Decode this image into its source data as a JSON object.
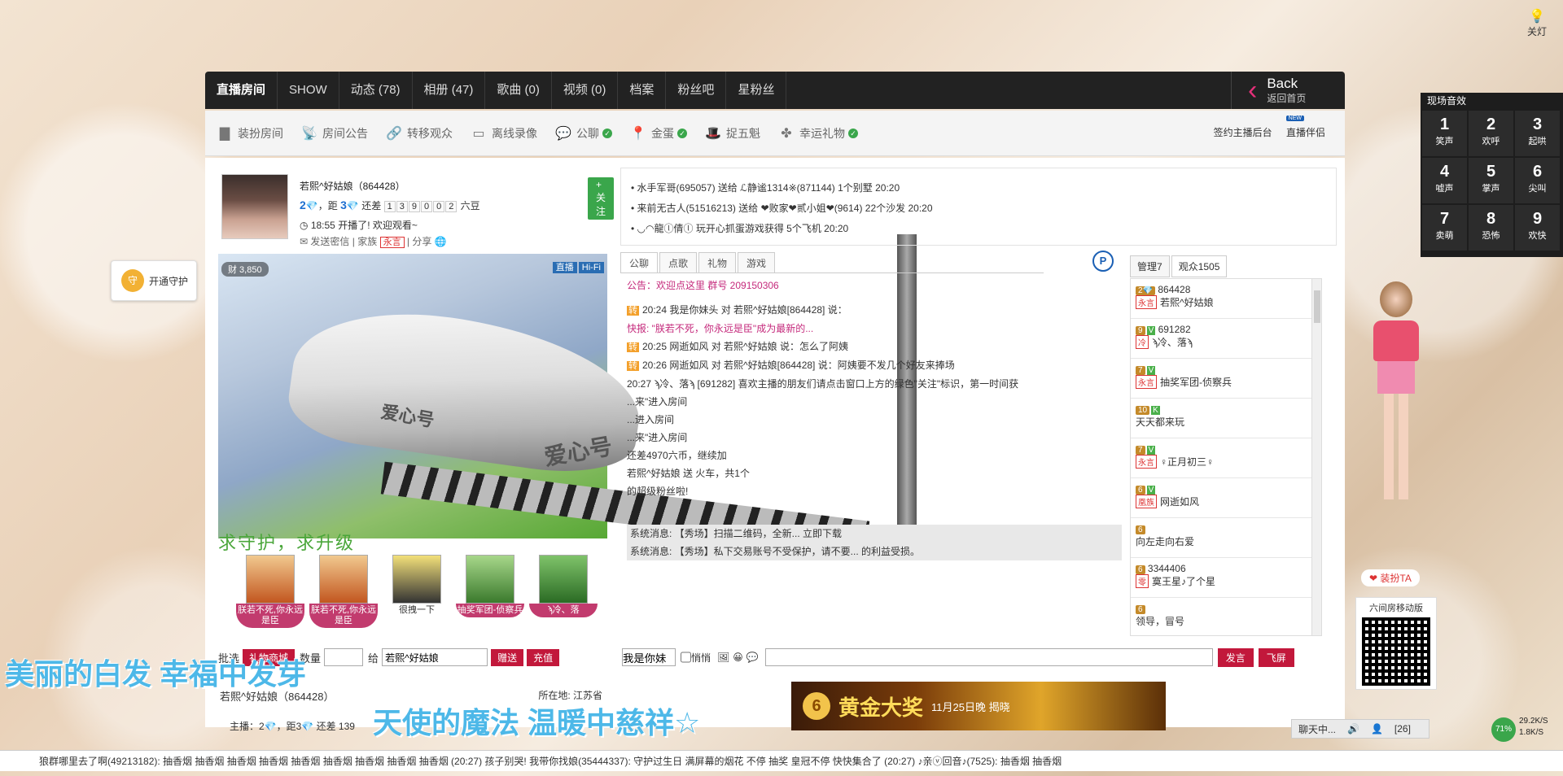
{
  "top_nav": {
    "tabs": [
      "直播房间",
      "SHOW",
      "动态 (78)",
      "相册 (47)",
      "歌曲 (0)",
      "视频 (0)",
      "档案",
      "粉丝吧",
      "星粉丝"
    ],
    "back_title": "Back",
    "back_sub": "返回首页"
  },
  "toolbar": {
    "items": [
      "装扮房间",
      "房间公告",
      "转移观众",
      "离线录像",
      "公聊",
      "金蛋",
      "捉五魁",
      "幸运礼物"
    ],
    "right_sign": "签约主播后台",
    "right_partner": "直播伴侣",
    "new_badge": "NEW"
  },
  "profile": {
    "name": "若熙^好姑娘（864428）",
    "follow": "+ 关注",
    "rank_prefix": "2",
    "rank_mid": "，距",
    "rank_next": "3",
    "rank_still": "还差",
    "digits": [
      "1",
      "3",
      "9",
      "0",
      "0",
      "2"
    ],
    "rank_unit": "六豆",
    "time_text": "18:55 开播了! 欢迎观看~",
    "send_msg": "发送密信",
    "clan_label": "家族",
    "clan_tag": "永言",
    "share": "分享"
  },
  "video": {
    "wealth": "财 3,850",
    "live": "直播",
    "hifi": "Hi-Fi",
    "train_label": "爱心号"
  },
  "guard_slogan": "求守护，求升级",
  "guard_button": "开通守护",
  "fans": [
    {
      "label": "朕若不死,你永远是臣"
    },
    {
      "label": "朕若不死,你永远是臣"
    },
    {
      "label": "很拽一下"
    },
    {
      "label": "抽奖军团-侦察兵"
    },
    {
      "label": "ϡ冷、落"
    }
  ],
  "gift_bar": {
    "batch": "批选",
    "gift_select": "礼物商城",
    "count_label": "数量",
    "to_label": "给",
    "recipient": "若熙^好姑娘",
    "give": "赠送",
    "recharge": "充值"
  },
  "anchor_info": {
    "name": "若熙^好姑娘（864428）",
    "location": "所在地: 江苏省",
    "rank": "主播：2💎，距3💎 还差 139"
  },
  "broadcast": {
    "lines": [
      "水手军哥(695057) 送给 ℒ静谧1314※(871144) 1个别墅 20:20",
      "来前无古人(51516213) 送给 ❤败家❤贰小姐❤(9614) 22个沙发 20:20",
      "◡◠龍ⓛ倩ⓛ 玩开心抓蛋游戏获得 5个飞机 20:20"
    ]
  },
  "chat_tabs": [
    "公聊",
    "点歌",
    "礼物",
    "游戏"
  ],
  "chat": {
    "notice": "公告：欢迎点这里 群号 209150306",
    "lines": [
      {
        "tag": "转",
        "time": "20:24",
        "text": "我是你妹头 对 若熙^好姑娘[864428] 说："
      },
      {
        "tag": "",
        "time": "",
        "text": "快报: \"朕若不死，你永远是臣\"成为最新的..."
      },
      {
        "tag": "转",
        "time": "20:25",
        "text": "网逝如风 对 若熙^好姑娘 说：怎么了阿姨"
      },
      {
        "tag": "转",
        "time": "20:26",
        "text": "网逝如风 对 若熙^好姑娘[864428] 说：阿姨要不发几个好友来捧场"
      },
      {
        "tag": "",
        "time": "20:27",
        "text": "ϡ冷、落ϡ [691282] 喜欢主播的朋友们请点击窗口上方的绿色\"关注\"标识，第一时间获"
      },
      {
        "tag": "",
        "time": "",
        "text": "...来\"进入房间"
      },
      {
        "tag": "",
        "time": "",
        "text": "...进入房间"
      },
      {
        "tag": "",
        "time": "",
        "text": "...来\"进入房间"
      },
      {
        "tag": "",
        "time": "",
        "text": "还差4970六币，继续加"
      },
      {
        "tag": "",
        "time": "",
        "text": "若熙^好姑娘 送 火车，共1个"
      },
      {
        "tag": "",
        "time": "",
        "text": "的超级粉丝啦!"
      }
    ],
    "sys1": "系统消息: 【秀场】扫描二维码，全新... 立即下载",
    "sys2": "系统消息: 【秀场】私下交易账号不受保护，请不要... 的利益受损。"
  },
  "chat_input": {
    "to_select": "我是你妹",
    "whisper": "悄悄",
    "send": "发言",
    "fly": "飞屏"
  },
  "banner": {
    "coin": "6",
    "title": "黄金大奖",
    "date": "11月25日晚 揭晓"
  },
  "users": {
    "tab_admin": "管理7",
    "tab_audience": "观众1505",
    "list": [
      {
        "level": "2💎",
        "id": "864428",
        "clan": "永言",
        "name": "若熙^好姑娘"
      },
      {
        "level": "9",
        "id": "691282",
        "clan": "冷",
        "name": "ϡ冷、落ϡ"
      },
      {
        "level": "7",
        "id": "",
        "clan": "永言",
        "name": "抽奖军团-侦察兵"
      },
      {
        "level": "10",
        "id": "",
        "clan": "",
        "name": "天天都来玩"
      },
      {
        "level": "7",
        "id": "",
        "clan": "永言",
        "name": "♀正月初三♀"
      },
      {
        "level": "6",
        "id": "",
        "clan": "凰族",
        "name": "网逝如风"
      },
      {
        "level": "6",
        "id": "",
        "clan": "",
        "name": "向左走向右爱"
      },
      {
        "level": "6",
        "id": "3344406",
        "clan": "零",
        "name": "寞王星♪了个星"
      },
      {
        "level": "6",
        "id": "",
        "clan": "",
        "name": "领导，冒号"
      }
    ]
  },
  "sound_board": {
    "title": "现场音效",
    "keys": [
      {
        "n": "1",
        "l": "笑声"
      },
      {
        "n": "2",
        "l": "欢呼"
      },
      {
        "n": "3",
        "l": "起哄"
      },
      {
        "n": "4",
        "l": "嘘声"
      },
      {
        "n": "5",
        "l": "掌声"
      },
      {
        "n": "6",
        "l": "尖叫"
      },
      {
        "n": "7",
        "l": "卖萌"
      },
      {
        "n": "8",
        "l": "恐怖"
      },
      {
        "n": "9",
        "l": "欢快"
      }
    ]
  },
  "light": "关灯",
  "dress": "❤ 装扮TA",
  "qr_title": "六间房移动版",
  "overlay": {
    "line1": "美丽的白发  幸福中发芽",
    "line2": "天使的魔法  温暖中慈祥☆"
  },
  "status": {
    "chat": "聊天中...",
    "count": "[26]",
    "cpu": "71%",
    "up": "29.2K/S",
    "down": "1.8K/S"
  },
  "ticker": "狼群哪里去了啊(49213182): 抽香烟 抽香烟 抽香烟 抽香烟 抽香烟 抽香烟 抽香烟 抽香烟 抽香烟 (20:27)  孩子别哭! 我带你找娘(35444337): 守护过生日 满屏幕的烟花 不停 抽奖 皇冠不停 快快集合了 (20:27)  ♪亲ⓥ回音♪(7525): 抽香烟 抽香烟"
}
